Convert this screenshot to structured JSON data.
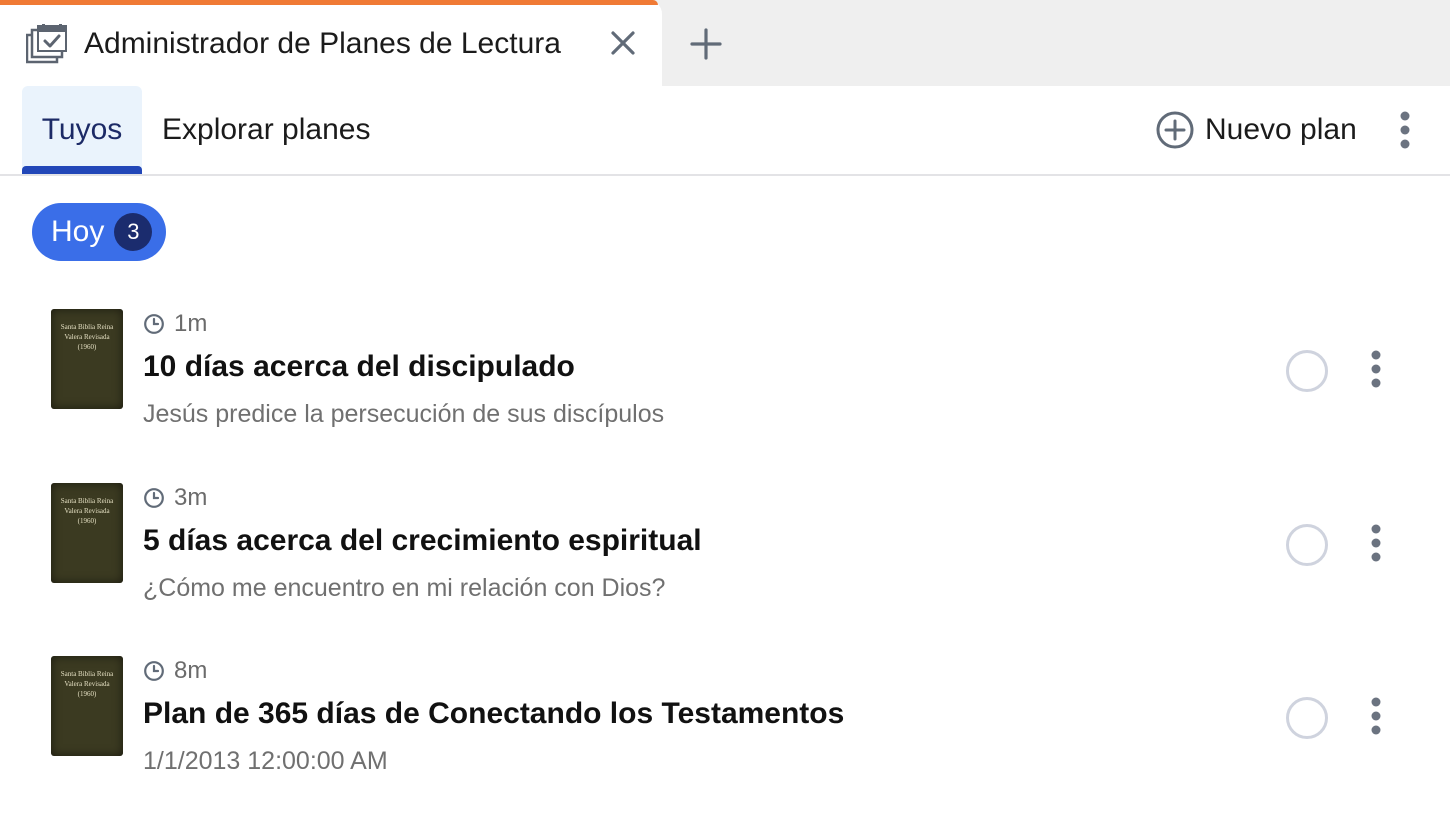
{
  "window_tab": {
    "title": "Administrador de Planes de Lectura",
    "icon": "reading-plans-calendar-icon",
    "close_icon": "close-icon",
    "new_tab_icon": "plus-icon"
  },
  "colors": {
    "tab_accent": "#f07a35",
    "active_tab_bg": "#eaf3fc",
    "active_tab_indicator": "#2247b8",
    "pill_bg": "#3a6ee8",
    "pill_badge_bg": "#1b2c6e"
  },
  "panel_tabs": [
    {
      "label": "Tuyos",
      "active": true
    },
    {
      "label": "Explorar planes",
      "active": false
    }
  ],
  "toolbar": {
    "new_plan_label": "Nuevo plan",
    "new_plan_icon": "plus-circle-icon",
    "more_icon": "more-vertical-icon"
  },
  "filter": {
    "label": "Hoy",
    "count": "3"
  },
  "plans": [
    {
      "cover_text": "Santa Biblia Reina Valera Revisada (1960)",
      "duration": "1m",
      "title": "10 días acerca del discipulado",
      "subtitle": "Jesús predice la persecución de sus discípulos",
      "completed": false
    },
    {
      "cover_text": "Santa Biblia Reina Valera Revisada (1960)",
      "duration": "3m",
      "title": "5 días acerca del crecimiento espiritual",
      "subtitle": "¿Cómo me encuentro en mi relación con Dios?",
      "completed": false
    },
    {
      "cover_text": "Santa Biblia Reina Valera Revisada (1960)",
      "duration": "8m",
      "title": "Plan de 365 días de Conectando los Testamentos",
      "subtitle": "1/1/2013 12:00:00 AM",
      "completed": false
    }
  ]
}
